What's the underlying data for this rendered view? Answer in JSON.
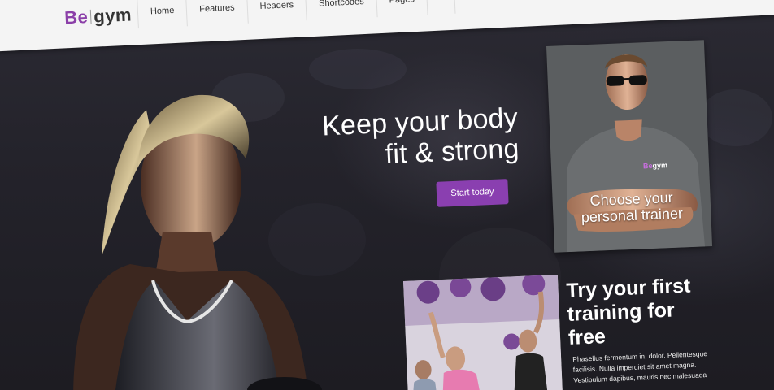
{
  "brand": {
    "logo_be": "Be",
    "logo_gym": "gym",
    "accent": "#8a3fb0"
  },
  "nav": {
    "items": [
      "Home",
      "Features",
      "Headers",
      "Shortcodes",
      "Pages",
      "",
      ""
    ]
  },
  "hero": {
    "title_line1": "Keep your body",
    "title_line2": "fit & strong",
    "cta_label": "Start today"
  },
  "trainer_card": {
    "line1": "Choose your",
    "line2": "personal trainer",
    "shirt_logo_be": "Be",
    "shirt_logo_gym": "gym"
  },
  "promo": {
    "title_line1": "Try your first",
    "title_line2": "training for",
    "title_line3": "free",
    "body_line1": "Phasellus fermentum in, dolor. Pellentesque",
    "body_line2": "facilisis. Nulla imperdiet sit amet magna.",
    "body_line3": "Vestibulum dapibus, mauris nec malesuada"
  }
}
